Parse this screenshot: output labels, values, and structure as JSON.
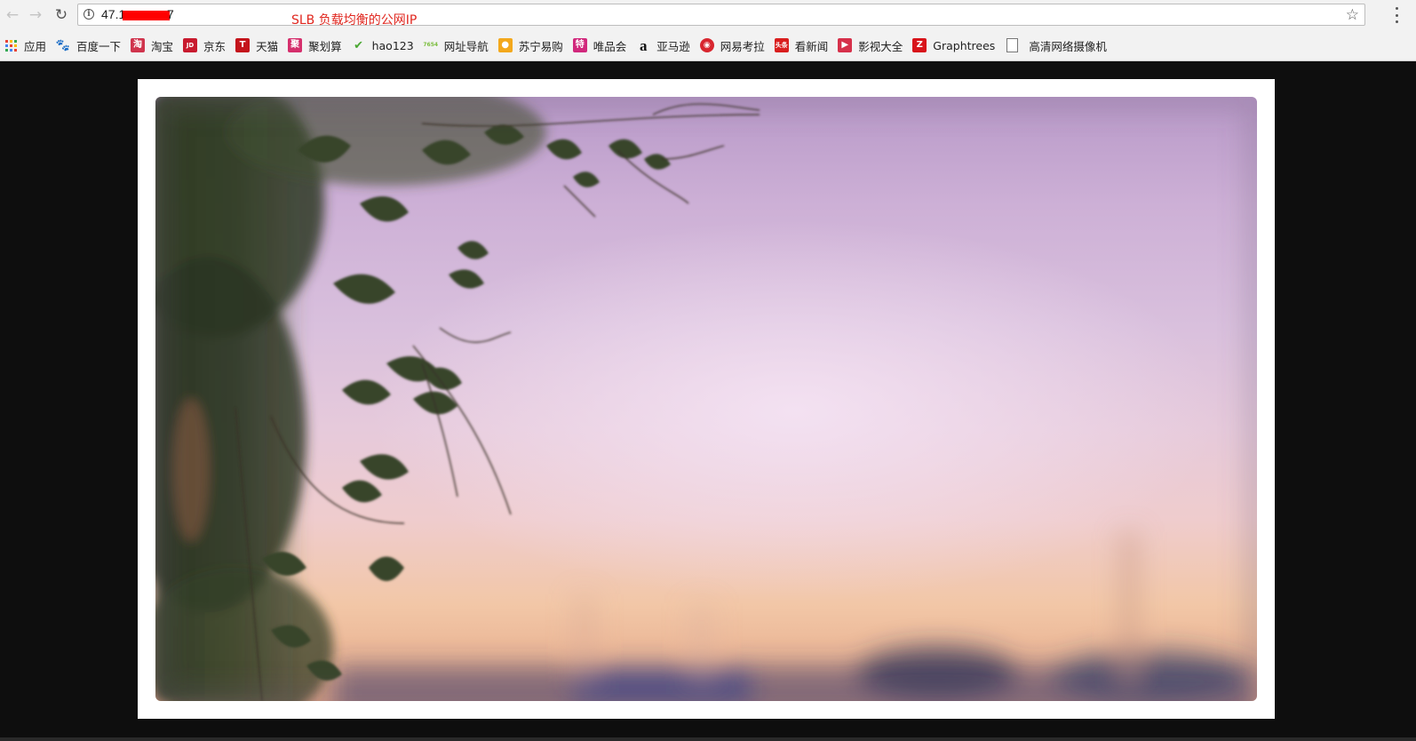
{
  "browser": {
    "url_visible_prefix": "47.1",
    "url_visible_suffix": "7",
    "annotation": "SLB 负载均衡的公网IP",
    "icons": {
      "back": "back-arrow-icon",
      "forward": "forward-arrow-icon",
      "reload": "reload-icon",
      "site_info": "info-icon",
      "bookmark_star": "star-icon",
      "menu": "vertical-dots-icon"
    }
  },
  "bookmarks": [
    {
      "label": "应用",
      "icon": "apps-grid-icon"
    },
    {
      "label": "百度一下",
      "icon": "baidu-paw-icon",
      "glyph": "🐾",
      "color": "#2f6fe0"
    },
    {
      "label": "淘宝",
      "icon": "taobao-icon",
      "glyph": "淘",
      "color": "#d0344d"
    },
    {
      "label": "京东",
      "icon": "jd-icon",
      "glyph": "JD",
      "color": "#c81a2e"
    },
    {
      "label": "天猫",
      "icon": "tmall-icon",
      "glyph": "T",
      "color": "#c4141b"
    },
    {
      "label": "聚划算",
      "icon": "juhuasuan-icon",
      "glyph": "聚",
      "color": "#d52f6c"
    },
    {
      "label": "hao123",
      "icon": "hao123-icon",
      "glyph": "✔",
      "color": "#4aa832"
    },
    {
      "label": "网址导航",
      "icon": "7654-icon",
      "glyph": "7654",
      "color": "#7bbd3e"
    },
    {
      "label": "苏宁易购",
      "icon": "suning-icon",
      "glyph": "●",
      "color": "#f3a81c"
    },
    {
      "label": "唯品会",
      "icon": "vip-icon",
      "glyph": "特",
      "color": "#d1287c"
    },
    {
      "label": "亚马逊",
      "icon": "amazon-icon",
      "glyph": "a",
      "color": "#111111"
    },
    {
      "label": "网易考拉",
      "icon": "kaola-icon",
      "glyph": "◉",
      "color": "#d8262f"
    },
    {
      "label": "看新闻",
      "icon": "news-icon",
      "glyph": "头条",
      "color": "#d91e1e"
    },
    {
      "label": "影视大全",
      "icon": "video-play-icon",
      "glyph": "▶",
      "color": "#d6304a"
    },
    {
      "label": "Graphtrees",
      "icon": "graphtrees-z-icon",
      "glyph": "Z",
      "color": "#d8141a"
    },
    {
      "label": "高清网络摄像机",
      "icon": "page-icon",
      "glyph": "",
      "color": "#ffffff"
    }
  ],
  "content": {
    "image": "sunset-vine-photo"
  }
}
